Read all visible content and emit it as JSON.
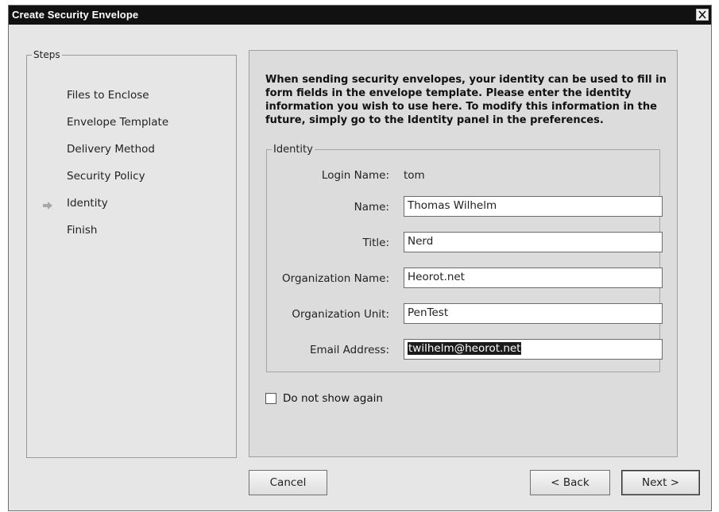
{
  "window": {
    "title": "Create Security Envelope"
  },
  "steps": {
    "legend": "Steps",
    "items": [
      {
        "label": "Files to Enclose"
      },
      {
        "label": "Envelope Template"
      },
      {
        "label": "Delivery Method"
      },
      {
        "label": "Security Policy"
      },
      {
        "label": "Identity",
        "current": true
      },
      {
        "label": "Finish"
      }
    ]
  },
  "content": {
    "intro": "When sending security envelopes, your identity can be used to fill in form fields in the envelope template. Please enter the identity information you wish to use here. To modify this information in the future, simply go to the Identity panel in the preferences.",
    "identity": {
      "legend": "Identity",
      "login_label": "Login Name:",
      "login_value": "tom",
      "name_label": "Name:",
      "name_value": "Thomas Wilhelm",
      "title_label": "Title:",
      "title_value": "Nerd",
      "org_label": "Organization Name:",
      "org_value": "Heorot.net",
      "unit_label": "Organization Unit:",
      "unit_value": "PenTest",
      "email_label": "Email Address:",
      "email_value": "twilhelm@heorot.net"
    },
    "do_not_show": {
      "label": "Do not show again",
      "checked": false
    }
  },
  "buttons": {
    "cancel": "Cancel",
    "back": "< Back",
    "next": "Next >"
  },
  "icons": {
    "close": "close-icon",
    "current_step": "arrow-right-icon"
  }
}
